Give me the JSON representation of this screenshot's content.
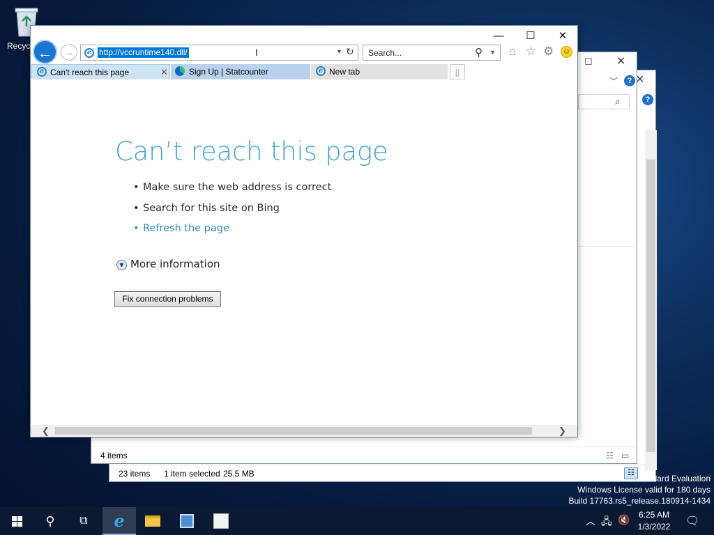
{
  "desktop": {
    "recycle_bin_label": "Recycl",
    "watermark": [
      "dard Evaluation",
      "Windows License valid for 180 days",
      "Build 17763.rs5_release.180914-1434"
    ]
  },
  "explorer_back": {
    "status_items": "23 items",
    "status_selected": "1 item selected",
    "status_size": "25.5 MB"
  },
  "explorer_mid": {
    "status_items": "4 items"
  },
  "ie": {
    "address_url": "http://vccruntime140.dll/",
    "search_placeholder": "Search...",
    "tabs": [
      {
        "label": "Can't reach this page",
        "active": true
      },
      {
        "label": "Sign Up | Statcounter",
        "active": false
      },
      {
        "label": "New tab",
        "active": false
      }
    ],
    "error_title": "Can’t reach this page",
    "bullets": [
      "Make sure the web address is correct",
      "Search for this site on Bing",
      "Refresh the page"
    ],
    "more_info": "More information",
    "fix_button": "Fix connection problems"
  },
  "taskbar": {
    "time": "6:25 AM",
    "date": "1/3/2022"
  },
  "icons": {
    "back": "back-arrow-icon",
    "forward": "forward-arrow-icon",
    "home": "home-icon",
    "favorites": "star-icon",
    "settings": "gear-icon",
    "feedback": "smiley-icon"
  },
  "colors": {
    "accent": "#0078d7",
    "error_title": "#40a3d6",
    "link": "#2e8dc6"
  }
}
